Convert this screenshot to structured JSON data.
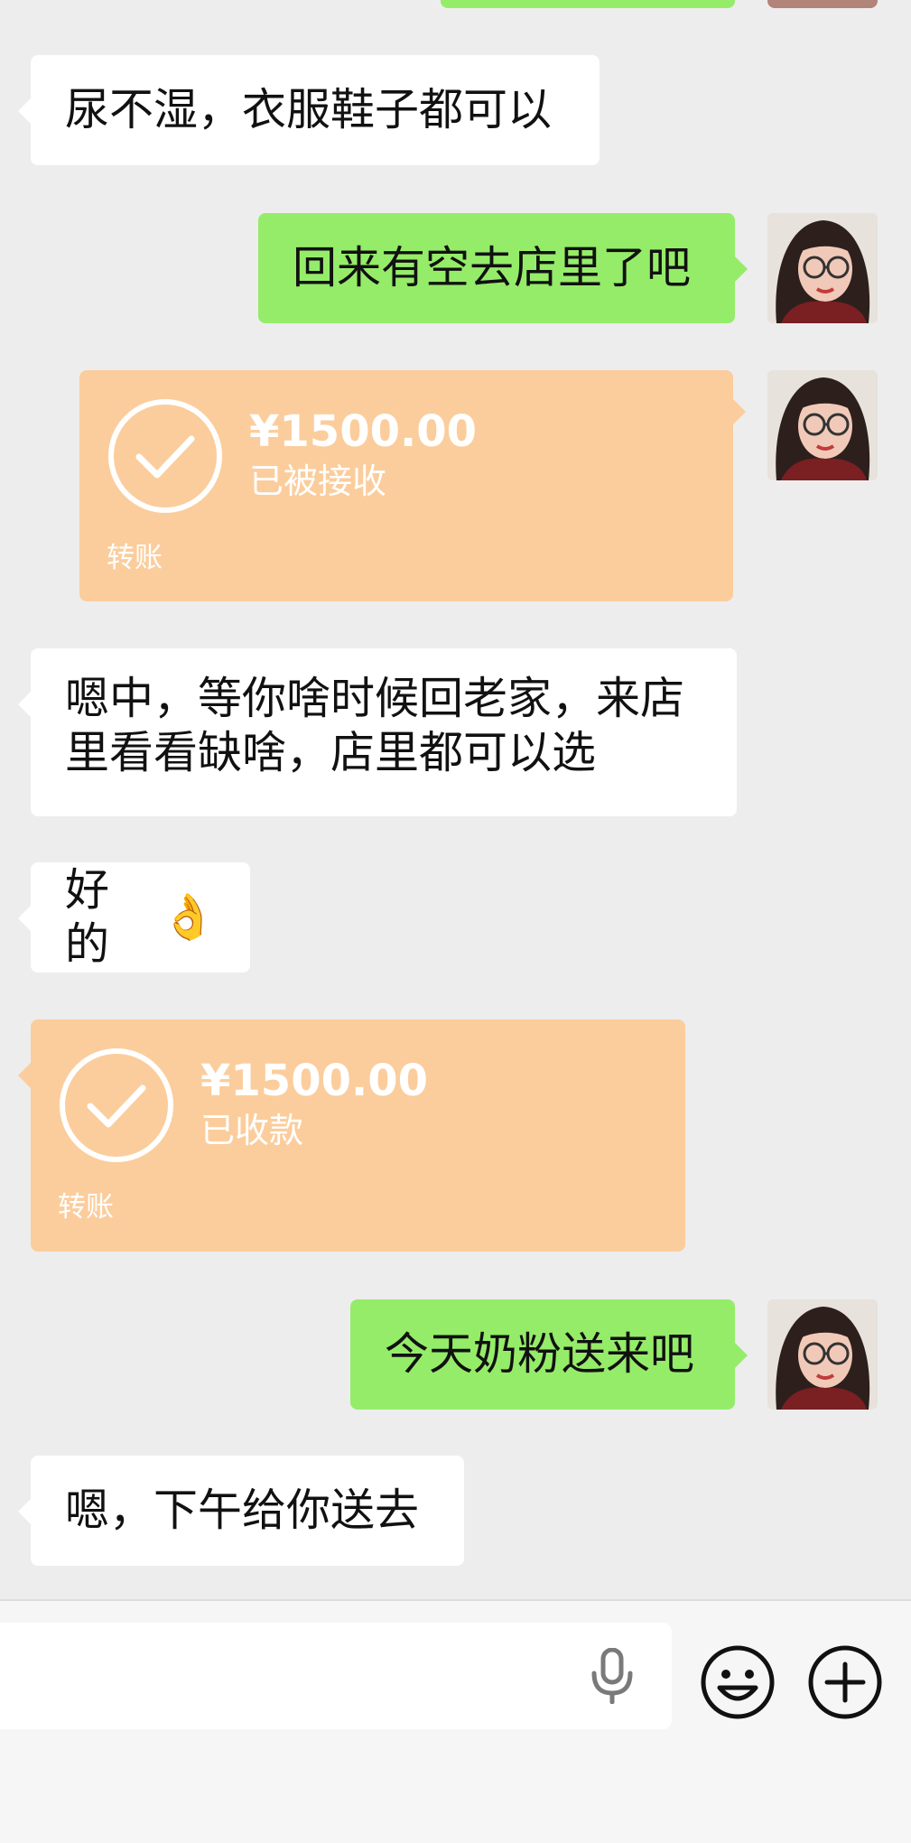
{
  "chat": {
    "msg1": "尿不湿，衣服鞋子都可以",
    "msg2": "回来有空去店里了吧",
    "transfer1": {
      "amount": "¥1500.00",
      "status": "已被接收",
      "kind": "转账"
    },
    "msg3_line1": "嗯中，等你啥时候回老家，来店",
    "msg3_line2": "里看看缺啥，店里都可以选",
    "msg4": "好的",
    "msg4_emoji": "👌",
    "transfer2": {
      "amount": "¥1500.00",
      "status": "已收款",
      "kind": "转账"
    },
    "msg5": "今天奶粉送来吧",
    "msg6": "嗯，下午给你送去"
  },
  "colors": {
    "background": "#ededed",
    "incoming_bubble": "#ffffff",
    "outgoing_bubble": "#95ec69",
    "transfer_card": "#fbcd9c"
  },
  "icons": {
    "avatar": "user-avatar-photo",
    "check": "check-circle-icon",
    "mic": "microphone-icon",
    "emoji": "smiley-face-icon",
    "plus": "plus-circle-icon"
  }
}
